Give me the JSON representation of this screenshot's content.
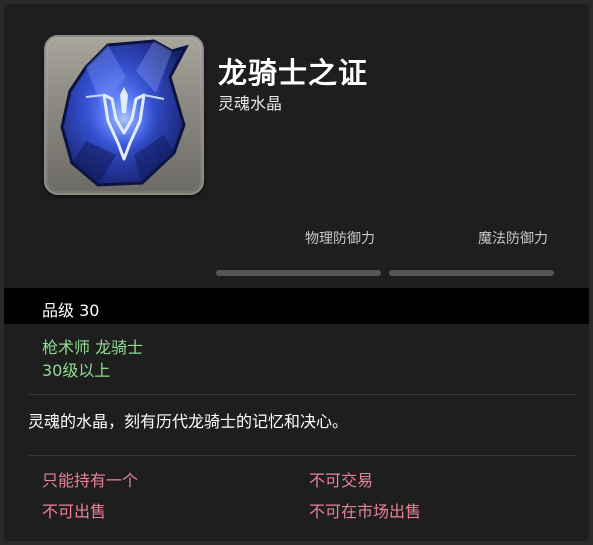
{
  "item": {
    "name": "龙骑士之证",
    "category": "灵魂水晶",
    "icon": "soul-crystal-dragoon-icon"
  },
  "stats": {
    "physical_defense_label": "物理防御力",
    "magic_defense_label": "魔法防御力"
  },
  "item_level": {
    "text": "品级 30"
  },
  "requirements": {
    "classes": "枪术师 龙骑士",
    "level": "30级以上"
  },
  "description": "灵魂的水晶，刻有历代龙骑士的记忆和决心。",
  "restrictions": {
    "unique": "只能持有一个",
    "untradable": "不可交易",
    "unsellable": "不可出售",
    "no_market": "不可在市场出售"
  },
  "colors": {
    "background": "#1e1e1e",
    "class_text": "#8fdc8f",
    "restriction_text": "#e8829a",
    "crystal_blue": "#3b5bd9"
  }
}
